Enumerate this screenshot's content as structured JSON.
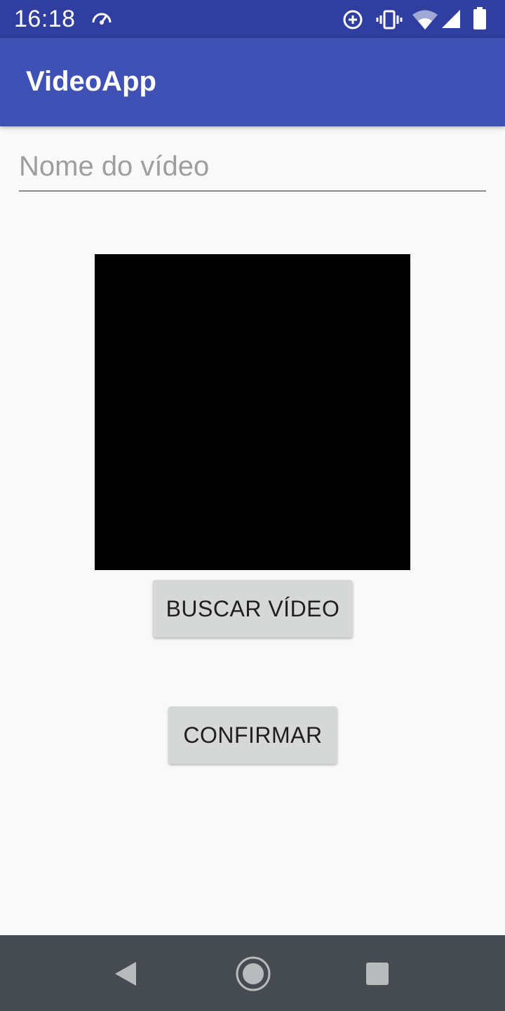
{
  "status_bar": {
    "time": "16:18",
    "icons": [
      "speedometer-icon",
      "data-saver-icon",
      "vibrate-icon",
      "wifi-icon",
      "cell-signal-icon",
      "battery-icon"
    ]
  },
  "app_bar": {
    "title": "VideoApp",
    "color": "#3f51b5"
  },
  "form": {
    "name_placeholder": "Nome do vídeo",
    "name_value": ""
  },
  "buttons": {
    "search_video": "BUSCAR VÍDEO",
    "confirm": "CONFIRMAR"
  },
  "nav_bar": {
    "icons": [
      "back-icon",
      "home-icon",
      "recents-icon"
    ]
  }
}
